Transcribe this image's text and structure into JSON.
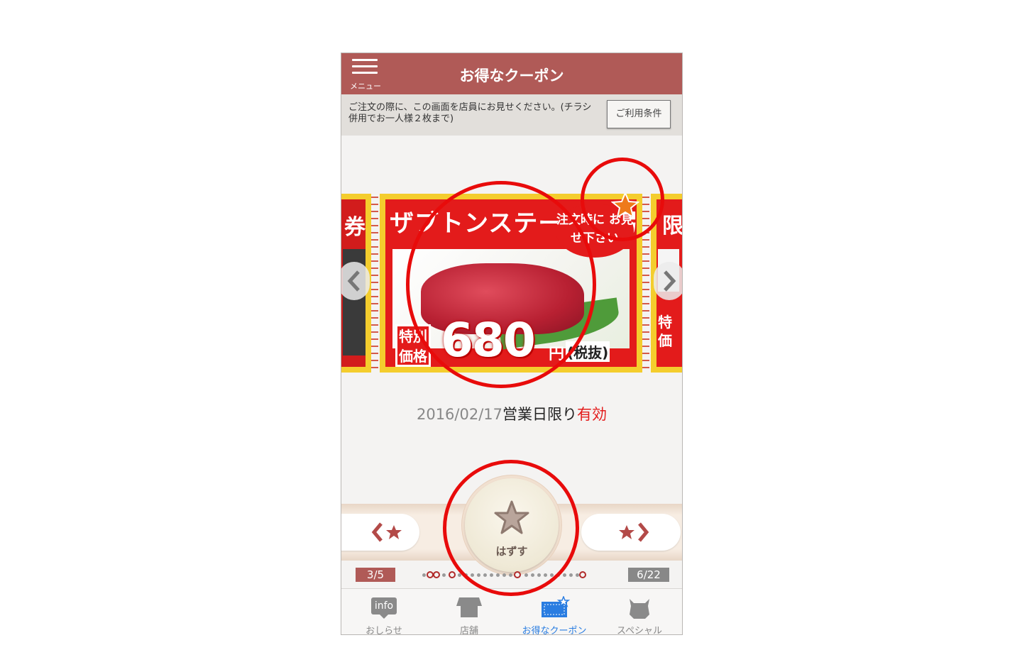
{
  "header": {
    "title": "お得なクーポン",
    "menu_label": "メニュー"
  },
  "notice": {
    "text": "ご注文の際に、この画面を店員にお見せください。(チラシ併用でお一人様２枚まで)",
    "terms_button": "ご利用条件"
  },
  "coupon": {
    "title": "ザブトンステーキ 割引券",
    "bubble": "注文時に お見せ下さい",
    "badge": "特別 価格",
    "price": "680",
    "yen": "円",
    "tax": "(税抜)",
    "left_partial_text": "券",
    "right_partial_text": "限",
    "right_partial_badge": "特 価"
  },
  "validity": {
    "date": "2016/02/17",
    "mid": "営業日限り",
    "status": "有効"
  },
  "actions": {
    "remove_label": "はずす"
  },
  "pager": {
    "current": "3/5",
    "total": "6/22"
  },
  "tabs": [
    {
      "label": "おしらせ",
      "icon_text": "info",
      "icon": "info-icon"
    },
    {
      "label": "店舗",
      "icon": "store-icon"
    },
    {
      "label": "お得なクーポン",
      "icon": "coupon-icon",
      "active": true
    },
    {
      "label": "スペシャル",
      "icon": "cow-icon"
    }
  ],
  "colors": {
    "header": "#b05a57",
    "accent_red": "#e31b1b",
    "active_tab": "#2a7de1",
    "annotation_ring": "#e80b0b"
  }
}
